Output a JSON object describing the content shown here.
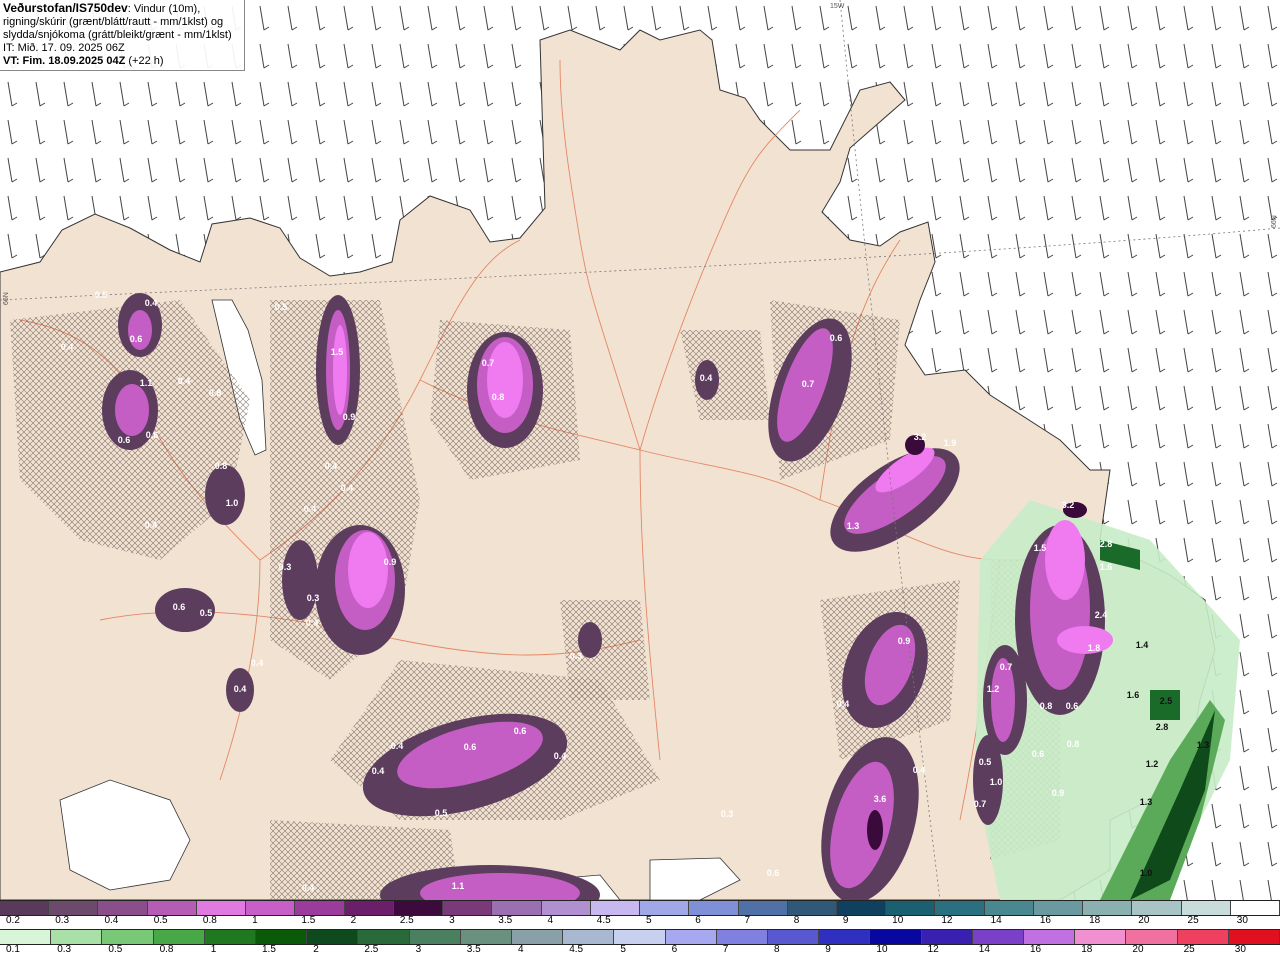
{
  "header": {
    "brand": "Veðurstofan/IS750dev",
    "line1_rest": ": Vindur (10m),",
    "line2": "rigning/skúrir (grænt/blátt/rautt - mm/1klst) og",
    "line3": "slydda/snjókoma (grátt/bleikt/grænt - mm/1klst)",
    "it": "IT: Mið. 17. 09. 2025 06Z",
    "vt": "VT: Fim. 18.09.2025 04Z",
    "lead": "(+22 h)"
  },
  "map_labels": {
    "edge_top": "15W",
    "edge_left": "66N",
    "edge_right": "66N"
  },
  "precip_values": [
    "0.5",
    "0.4",
    "0.6",
    "0.4",
    "1.1",
    "0.4",
    "0.8",
    "0.6",
    "0.6",
    "0.8",
    "1.0",
    "0.4",
    "0.5",
    "1.5",
    "0.9",
    "0.4",
    "0.4",
    "0.4",
    "0.3",
    "0.9",
    "0.3",
    "0.4",
    "0.6",
    "0.5",
    "0.4",
    "0.4",
    "0.7",
    "0.8",
    "0.4",
    "0.6",
    "0.7",
    "3.2",
    "1.9",
    "1.3",
    "0.9",
    "0.4",
    "0.3",
    "0.4",
    "0.6",
    "0.6",
    "0.4",
    "0.4",
    "0.5",
    "3.6",
    "0.4",
    "0.3",
    "0.6",
    "1.1",
    "0.4",
    "3.2",
    "1.5",
    "2.8",
    "1.6",
    "2.4",
    "1.8",
    "1.4",
    "1.6",
    "2.5",
    "2.8",
    "1.3",
    "1.2",
    "0.7",
    "0.8",
    "0.6",
    "0.8",
    "0.5",
    "1.0",
    "0.7",
    "0.6",
    "0.9",
    "1.2",
    "1.3",
    "1.0"
  ],
  "legend_snow": {
    "ticks": [
      "0.2",
      "0.3",
      "0.4",
      "0.5",
      "0.8",
      "1",
      "1.5",
      "2",
      "2.5",
      "3",
      "3.5",
      "4",
      "4.5",
      "5",
      "6",
      "7",
      "8",
      "9",
      "10",
      "12",
      "14",
      "16",
      "18",
      "20",
      "25",
      "30"
    ],
    "colors": [
      "#5a3a5a",
      "#6b4a6b",
      "#8a4f8a",
      "#b55db5",
      "#e07ae0",
      "#c85ec8",
      "#9b3b9b",
      "#6b1f6b",
      "#3d0a3d",
      "#7a3a7a",
      "#9a70b0",
      "#b090d0",
      "#c8b8f0",
      "#a0a8e8",
      "#8090d8",
      "#5070a8",
      "#305878",
      "#104060",
      "#1a6070",
      "#2a7080",
      "#4a8890",
      "#6a9aa0",
      "#8ab0b0",
      "#a8c4c4",
      "#c8dcdc",
      "#ffffff"
    ]
  },
  "legend_rain": {
    "ticks": [
      "0.1",
      "0.3",
      "0.5",
      "0.8",
      "1",
      "1.5",
      "2",
      "2.5",
      "3",
      "3.5",
      "4",
      "4.5",
      "5",
      "6",
      "7",
      "8",
      "9",
      "10",
      "12",
      "14",
      "16",
      "18",
      "20",
      "25",
      "30"
    ],
    "colors": [
      "#d8f5d8",
      "#a8e0a8",
      "#78c878",
      "#48a848",
      "#207820",
      "#0a5a0a",
      "#0f4a1f",
      "#2a6a3a",
      "#4a8060",
      "#6a9080",
      "#8aa0a8",
      "#a8b8d0",
      "#c8d0f0",
      "#a8a8f0",
      "#8080e0",
      "#5858d0",
      "#3030c0",
      "#0808a0",
      "#3a20b0",
      "#7a40c8",
      "#c070e0",
      "#f090d0",
      "#f070a0",
      "#f04060",
      "#e01020"
    ]
  }
}
